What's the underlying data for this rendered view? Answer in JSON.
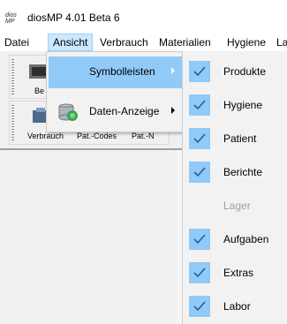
{
  "window": {
    "app_icon_line1": "dios",
    "app_icon_line2": "MP",
    "title": "diosMP  4.01 Beta 6"
  },
  "menubar": {
    "items": [
      {
        "label": "Datei"
      },
      {
        "label": "Ansicht"
      },
      {
        "label": "Verbrauch"
      },
      {
        "label": "Materialien"
      },
      {
        "label": "Hygiene"
      },
      {
        "label": "La"
      }
    ],
    "active": "Ansicht"
  },
  "toolbar": {
    "row1_partial_label": "Be",
    "row2_labels": [
      "Verbrauch",
      "Pat.-Codes",
      "Pat.-N"
    ]
  },
  "ansicht_menu": {
    "items": [
      {
        "label": "Symbolleisten",
        "has_submenu": true,
        "highlighted": true
      },
      {
        "label": "Daten-Anzeige",
        "has_submenu": true,
        "highlighted": false,
        "icon": "database-display-icon"
      }
    ]
  },
  "symbolleisten_submenu": {
    "items": [
      {
        "label": "Produkte",
        "checked": true,
        "enabled": true
      },
      {
        "label": "Hygiene",
        "checked": true,
        "enabled": true
      },
      {
        "label": "Patient",
        "checked": true,
        "enabled": true
      },
      {
        "label": "Berichte",
        "checked": true,
        "enabled": true
      },
      {
        "label": "Lager",
        "checked": false,
        "enabled": false
      },
      {
        "label": "Aufgaben",
        "checked": true,
        "enabled": true
      },
      {
        "label": "Extras",
        "checked": true,
        "enabled": true
      },
      {
        "label": "Labor",
        "checked": true,
        "enabled": true
      }
    ]
  },
  "colors": {
    "highlight": "#91c9f7",
    "menu_bg": "#f2f2f2",
    "active_menu_bg": "#cce8ff",
    "disabled_text": "#a0a0a0"
  }
}
